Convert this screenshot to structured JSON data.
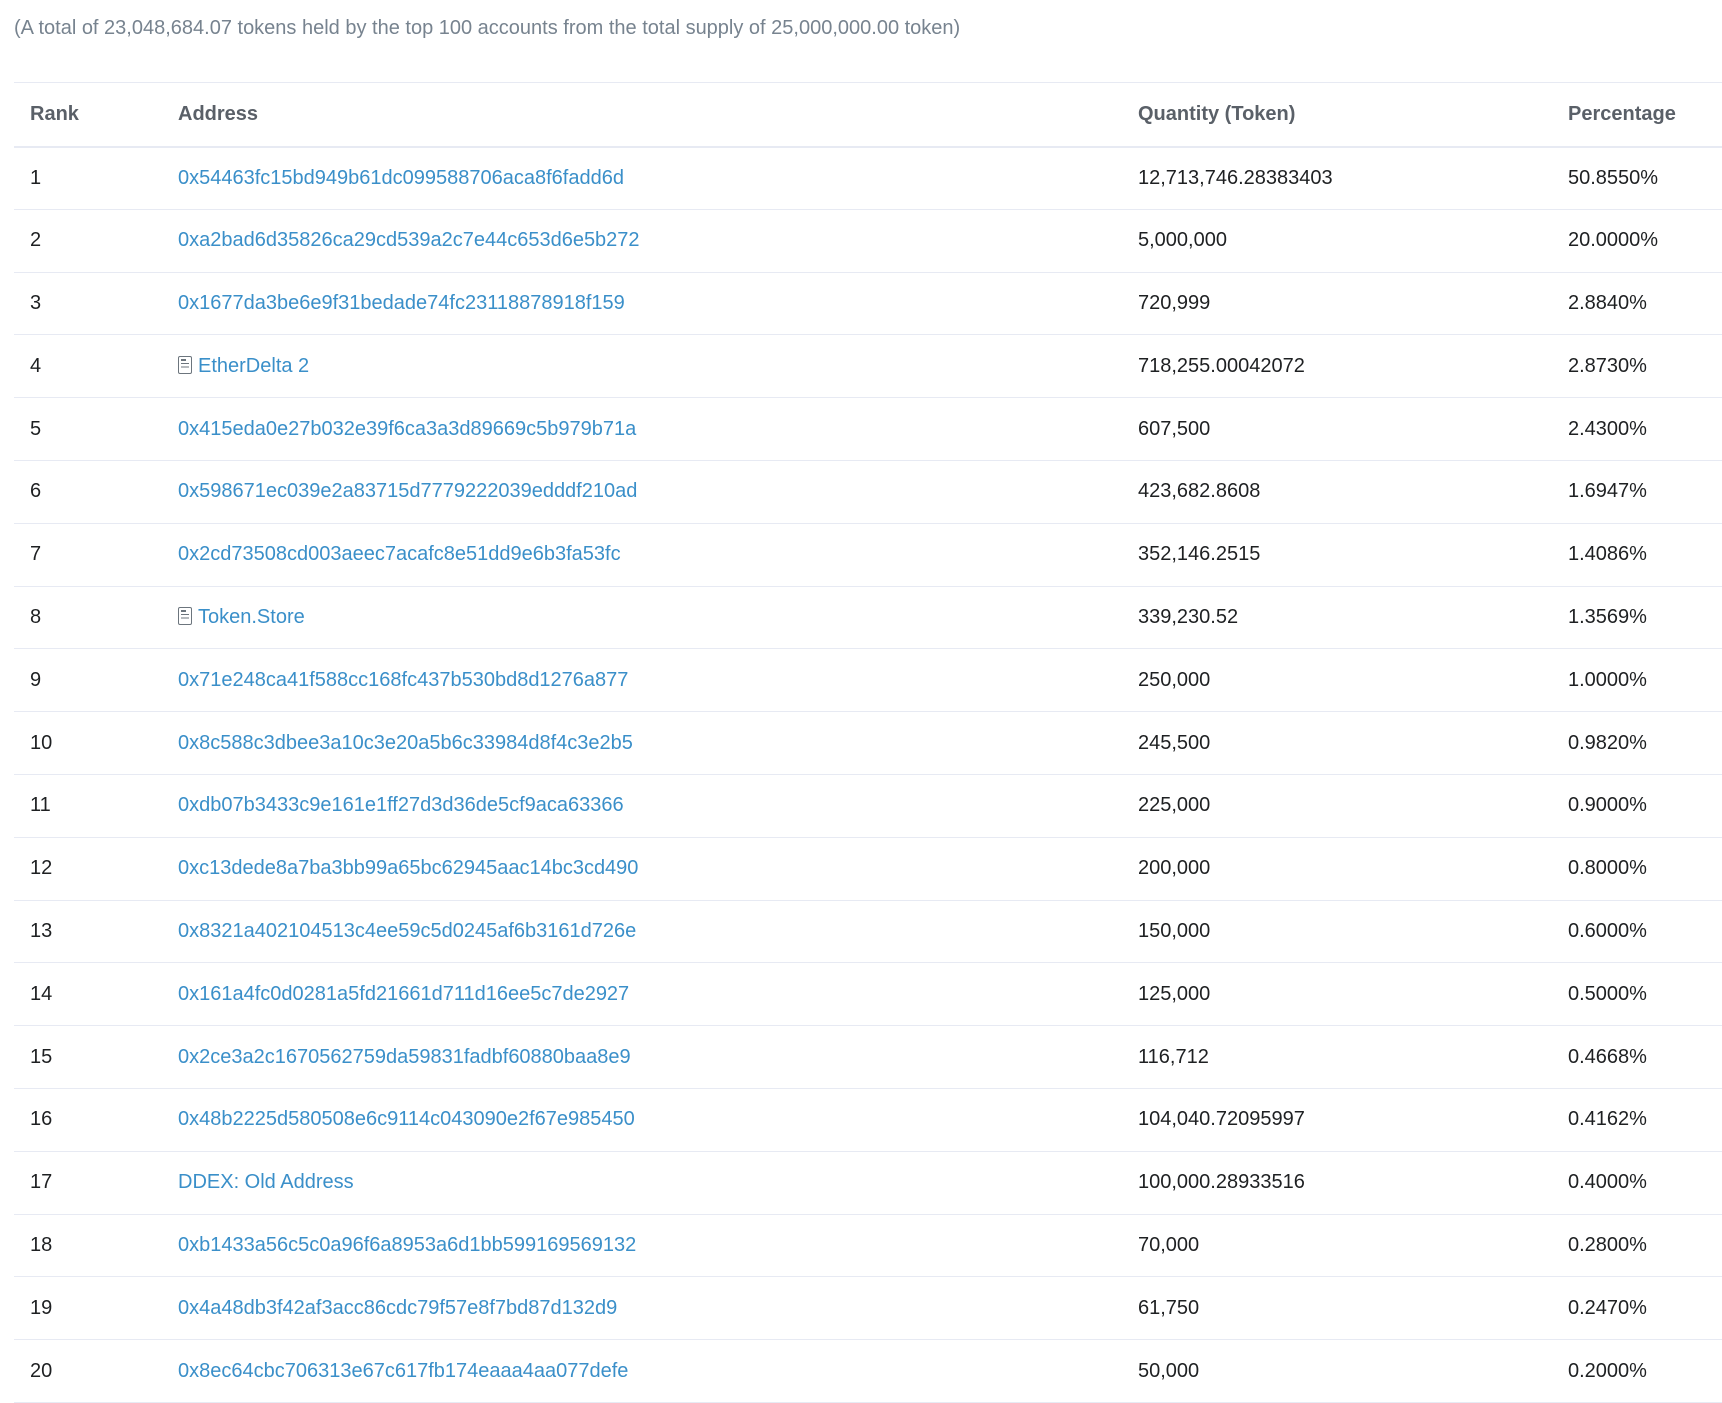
{
  "summary": "(A total of 23,048,684.07 tokens held by the top 100 accounts from the total supply of 25,000,000.00 token)",
  "table": {
    "headers": {
      "rank": "Rank",
      "address": "Address",
      "quantity": "Quantity (Token)",
      "percentage": "Percentage"
    },
    "rows": [
      {
        "rank": "1",
        "address": "0x54463fc15bd949b61dc099588706aca8f6fadd6d",
        "contract": false,
        "quantity": "12,713,746.28383403",
        "percentage": "50.8550%"
      },
      {
        "rank": "2",
        "address": "0xa2bad6d35826ca29cd539a2c7e44c653d6e5b272",
        "contract": false,
        "quantity": "5,000,000",
        "percentage": "20.0000%"
      },
      {
        "rank": "3",
        "address": "0x1677da3be6e9f31bedade74fc23118878918f159",
        "contract": false,
        "quantity": "720,999",
        "percentage": "2.8840%"
      },
      {
        "rank": "4",
        "address": "EtherDelta 2",
        "contract": true,
        "quantity": "718,255.00042072",
        "percentage": "2.8730%"
      },
      {
        "rank": "5",
        "address": "0x415eda0e27b032e39f6ca3a3d89669c5b979b71a",
        "contract": false,
        "quantity": "607,500",
        "percentage": "2.4300%"
      },
      {
        "rank": "6",
        "address": "0x598671ec039e2a83715d7779222039edddf210ad",
        "contract": false,
        "quantity": "423,682.8608",
        "percentage": "1.6947%"
      },
      {
        "rank": "7",
        "address": "0x2cd73508cd003aeec7acafc8e51dd9e6b3fa53fc",
        "contract": false,
        "quantity": "352,146.2515",
        "percentage": "1.4086%"
      },
      {
        "rank": "8",
        "address": "Token.Store",
        "contract": true,
        "quantity": "339,230.52",
        "percentage": "1.3569%"
      },
      {
        "rank": "9",
        "address": "0x71e248ca41f588cc168fc437b530bd8d1276a877",
        "contract": false,
        "quantity": "250,000",
        "percentage": "1.0000%"
      },
      {
        "rank": "10",
        "address": "0x8c588c3dbee3a10c3e20a5b6c33984d8f4c3e2b5",
        "contract": false,
        "quantity": "245,500",
        "percentage": "0.9820%"
      },
      {
        "rank": "11",
        "address": "0xdb07b3433c9e161e1ff27d3d36de5cf9aca63366",
        "contract": false,
        "quantity": "225,000",
        "percentage": "0.9000%"
      },
      {
        "rank": "12",
        "address": "0xc13dede8a7ba3bb99a65bc62945aac14bc3cd490",
        "contract": false,
        "quantity": "200,000",
        "percentage": "0.8000%"
      },
      {
        "rank": "13",
        "address": "0x8321a402104513c4ee59c5d0245af6b3161d726e",
        "contract": false,
        "quantity": "150,000",
        "percentage": "0.6000%"
      },
      {
        "rank": "14",
        "address": "0x161a4fc0d0281a5fd21661d711d16ee5c7de2927",
        "contract": false,
        "quantity": "125,000",
        "percentage": "0.5000%"
      },
      {
        "rank": "15",
        "address": "0x2ce3a2c1670562759da59831fadbf60880baa8e9",
        "contract": false,
        "quantity": "116,712",
        "percentage": "0.4668%"
      },
      {
        "rank": "16",
        "address": "0x48b2225d580508e6c9114c043090e2f67e985450",
        "contract": false,
        "quantity": "104,040.72095997",
        "percentage": "0.4162%"
      },
      {
        "rank": "17",
        "address": "DDEX: Old Address",
        "contract": false,
        "quantity": "100,000.28933516",
        "percentage": "0.4000%"
      },
      {
        "rank": "18",
        "address": "0xb1433a56c5c0a96f6a8953a6d1bb599169569132",
        "contract": false,
        "quantity": "70,000",
        "percentage": "0.2800%"
      },
      {
        "rank": "19",
        "address": "0x4a48db3f42af3acc86cdc79f57e8f7bd87d132d9",
        "contract": false,
        "quantity": "61,750",
        "percentage": "0.2470%"
      },
      {
        "rank": "20",
        "address": "0x8ec64cbc706313e67c617fb174eaaa4aa077defe",
        "contract": false,
        "quantity": "50,000",
        "percentage": "0.2000%"
      }
    ]
  },
  "icons": {
    "contract": "contract-document-icon"
  },
  "colors": {
    "link": "#3a8fc9",
    "muted_text": "#77838f",
    "border": "#e7eaf3"
  }
}
